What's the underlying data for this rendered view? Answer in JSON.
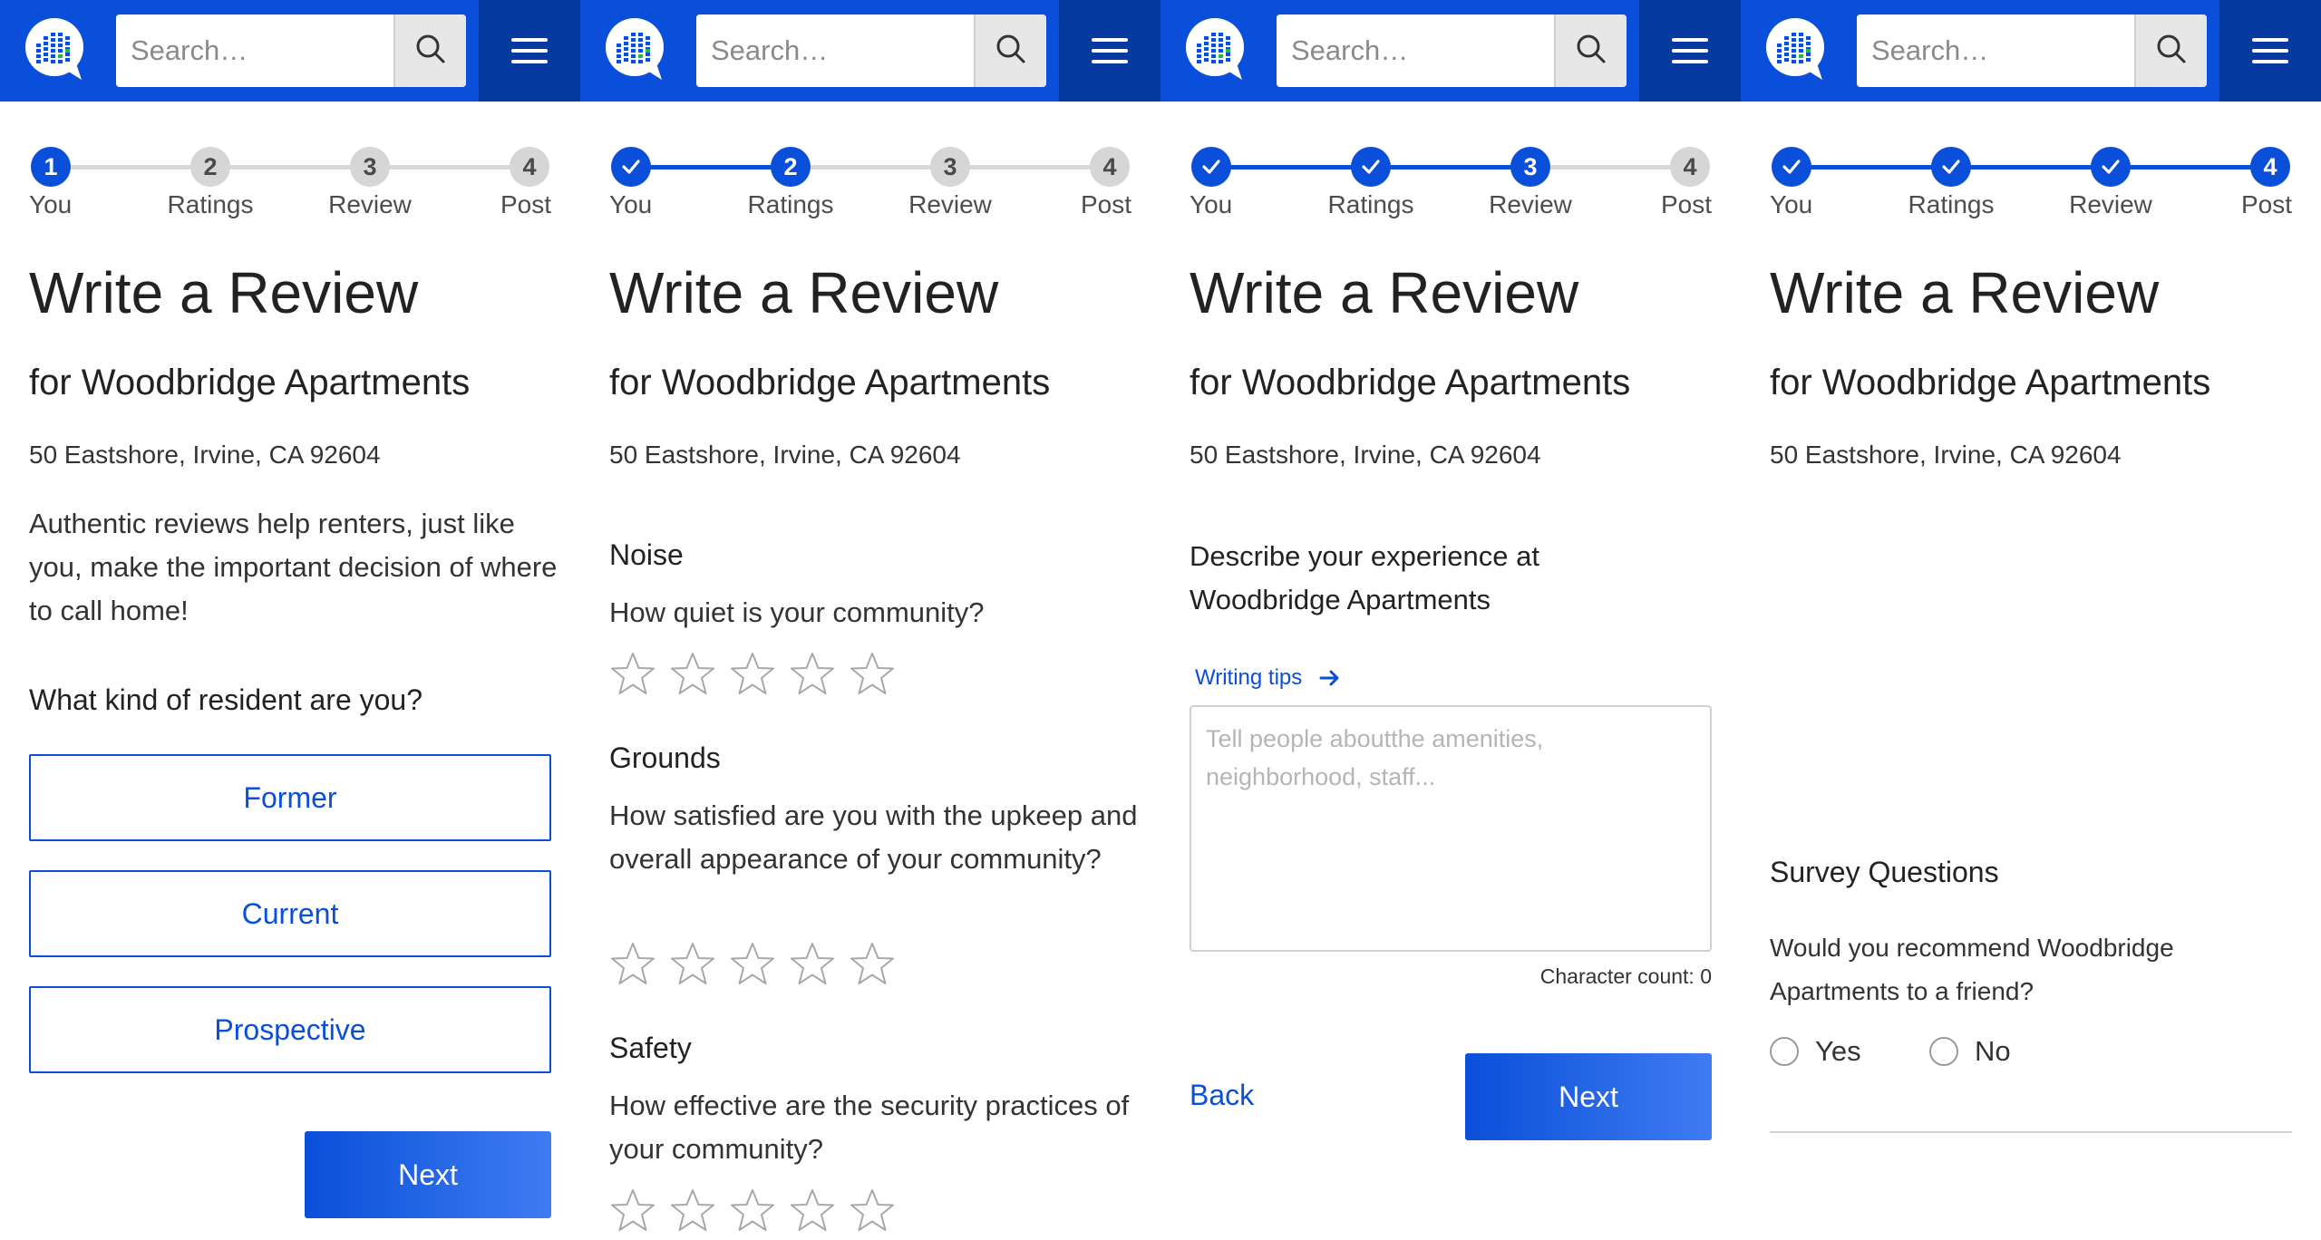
{
  "colors": {
    "brand_blue": "#0a4fd9",
    "menu_blue": "#04399f",
    "step_todo": "#d6d6d6"
  },
  "header": {
    "search_placeholder": "Search…",
    "logo_icon": "building-globe-logo",
    "search_icon": "magnifier-icon",
    "menu_icon": "hamburger-icon"
  },
  "panels": [
    {
      "stepper": {
        "steps": [
          {
            "number": "1",
            "label": "You",
            "state": "current"
          },
          {
            "number": "2",
            "label": "Ratings",
            "state": "todo"
          },
          {
            "number": "3",
            "label": "Review",
            "state": "todo"
          },
          {
            "number": "4",
            "label": "Post",
            "state": "todo"
          }
        ]
      },
      "title": "Write a Review",
      "subtitle": "for Woodbridge Apartments",
      "address": "50 Eastshore, Irvine, CA 92604",
      "intro": "Authentic reviews help renters, just like you, make the important decision of where to call home!",
      "question": "What kind of resident are you?",
      "choices": [
        "Former",
        "Current",
        "Prospective"
      ],
      "next_label": "Next"
    },
    {
      "stepper": {
        "steps": [
          {
            "number": "",
            "label": "You",
            "state": "done"
          },
          {
            "number": "2",
            "label": "Ratings",
            "state": "current"
          },
          {
            "number": "3",
            "label": "Review",
            "state": "todo"
          },
          {
            "number": "4",
            "label": "Post",
            "state": "todo"
          }
        ]
      },
      "title": "Write a Review",
      "subtitle": "for Woodbridge Apartments",
      "address": "50 Eastshore, Irvine, CA 92604",
      "ratings": [
        {
          "label": "Noise",
          "question": "How quiet is your community?",
          "stars": 0
        },
        {
          "label": "Grounds",
          "question": "How satisfied are you with the upkeep and overall appearance of your community?",
          "stars": 0
        },
        {
          "label": "Safety",
          "question": "How effective are the security practices of your community?",
          "stars": 0
        }
      ]
    },
    {
      "stepper": {
        "steps": [
          {
            "number": "",
            "label": "You",
            "state": "done"
          },
          {
            "number": "",
            "label": "Ratings",
            "state": "done"
          },
          {
            "number": "3",
            "label": "Review",
            "state": "current"
          },
          {
            "number": "4",
            "label": "Post",
            "state": "todo"
          }
        ]
      },
      "title": "Write a Review",
      "subtitle": "for Woodbridge Apartments",
      "address": "50 Eastshore, Irvine, CA 92604",
      "describe": "Describe your experience at Woodbridge Apartments",
      "writing_tips": "Writing tips",
      "textarea_placeholder": "Tell people aboutthe amenities, neighborhood, staff...",
      "char_count": "Character count: 0",
      "back_label": "Back",
      "next_label": "Next"
    },
    {
      "stepper": {
        "steps": [
          {
            "number": "",
            "label": "You",
            "state": "done"
          },
          {
            "number": "",
            "label": "Ratings",
            "state": "done"
          },
          {
            "number": "",
            "label": "Review",
            "state": "done"
          },
          {
            "number": "4",
            "label": "Post",
            "state": "current"
          }
        ]
      },
      "title": "Write a Review",
      "subtitle": "for Woodbridge Apartments",
      "address": "50 Eastshore, Irvine, CA 92604",
      "survey_title": "Survey Questions",
      "survey_question": "Would you recommend Woodbridge Apartments to a friend?",
      "options": [
        "Yes",
        "No"
      ]
    }
  ]
}
